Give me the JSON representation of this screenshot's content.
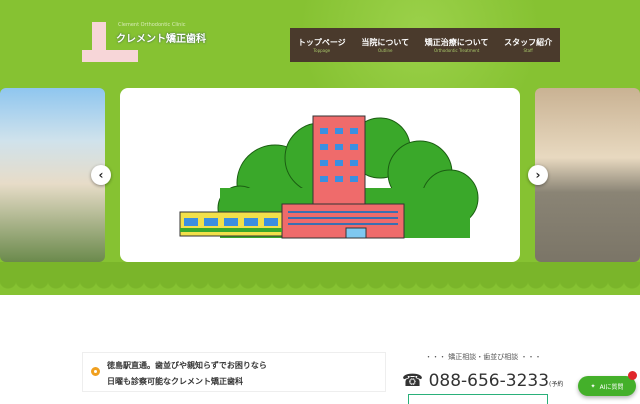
{
  "logo": {
    "en": "Clement Orthodontic Clinic",
    "jp": "クレメント矯正歯科"
  },
  "nav": [
    {
      "label": "トップページ",
      "sub": "Toppage"
    },
    {
      "label": "当院について",
      "sub": "Outline"
    },
    {
      "label": "矯正治療について",
      "sub": "Orthodontic Treatment"
    },
    {
      "label": "スタッフ紹介",
      "sub": "Staff"
    }
  ],
  "slider": {
    "prev": "‹",
    "next": "›"
  },
  "message": {
    "line1": "徳島駅直通。歯並びや親知らずでお困りなら",
    "line2": "日曜も診察可能なクレメント矯正歯科"
  },
  "contact": {
    "heading": "・・・ 矯正相談・歯並び相談 ・・・",
    "phone": "088-656-3233",
    "note": "(予約"
  },
  "ai_button": {
    "label": "AIに質問"
  }
}
